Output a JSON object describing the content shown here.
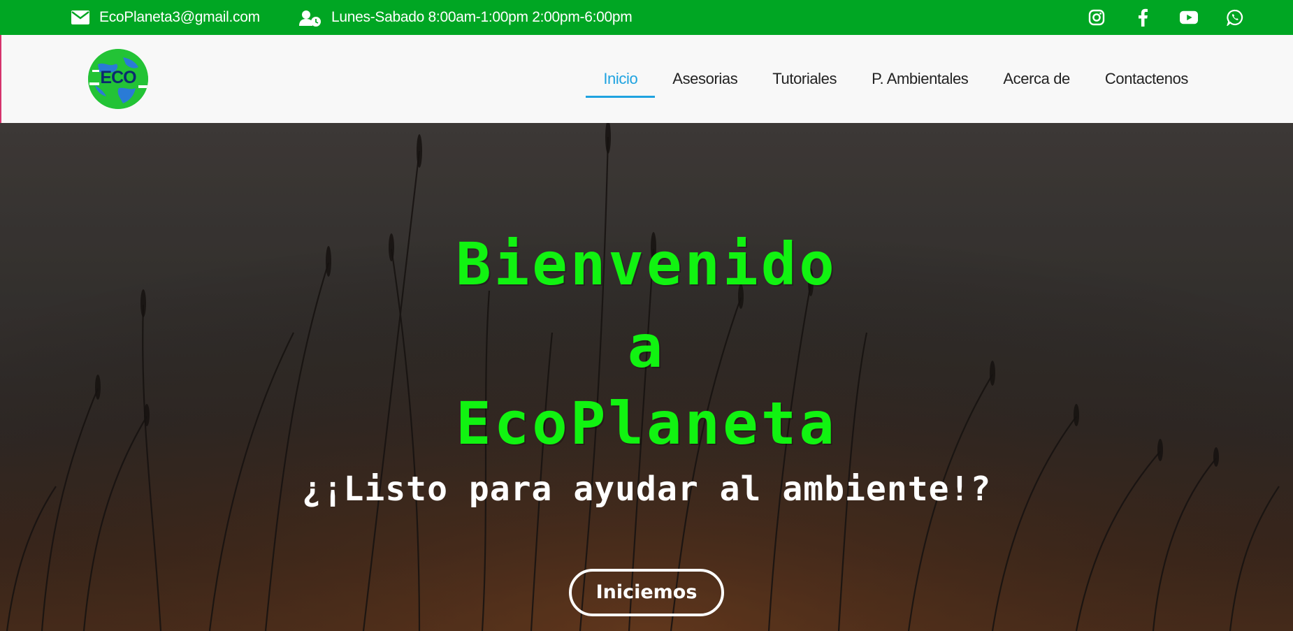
{
  "topbar": {
    "background": "#00a623",
    "email": {
      "icon": "envelope-icon",
      "text": "EcoPlaneta3@gmail.com"
    },
    "hours": {
      "icon": "user-clock-icon",
      "text": "Lunes-Sabado 8:00am-1:00pm 2:00pm-6:00pm"
    },
    "socials": [
      {
        "icon": "instagram-icon"
      },
      {
        "icon": "facebook-icon"
      },
      {
        "icon": "youtube-icon"
      },
      {
        "icon": "whatsapp-icon"
      }
    ]
  },
  "navbar": {
    "logo_text": "ECO",
    "items": [
      {
        "label": "Inicio",
        "active": true
      },
      {
        "label": "Asesorias"
      },
      {
        "label": "Tutoriales"
      },
      {
        "label": "P. Ambientales"
      },
      {
        "label": "Acerca de"
      },
      {
        "label": "Contactenos"
      }
    ],
    "active_color": "#1fa3e0"
  },
  "hero": {
    "title_line1": "Bienvenido",
    "title_line2": "a",
    "title_line3": "EcoPlaneta",
    "subtitle": "¿¡Listo para ayudar al ambiente!?",
    "button_label": "Iniciemos",
    "title_color": "#11f311"
  }
}
